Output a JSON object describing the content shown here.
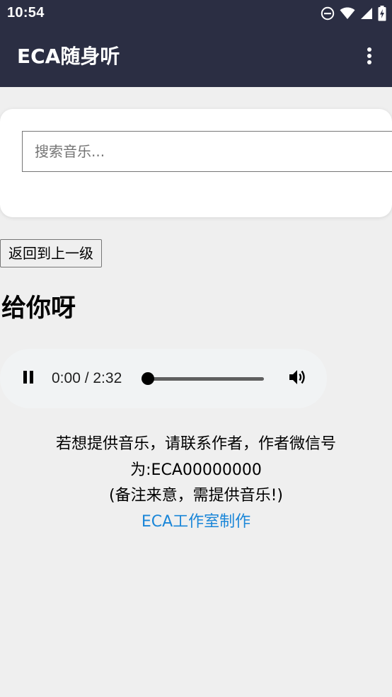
{
  "status_bar": {
    "time": "10:54",
    "icons": [
      "do-not-disturb-icon",
      "wifi-icon",
      "cell-signal-icon",
      "battery-charging-icon"
    ]
  },
  "app_bar": {
    "title": "ECA随身听",
    "menu_icon": "more-vert-icon"
  },
  "search": {
    "placeholder": "搜索音乐..."
  },
  "back_button": {
    "label": "返回到上一级"
  },
  "song": {
    "title": "给你呀"
  },
  "player": {
    "time": "0:00 / 2:32",
    "current": "0:00",
    "duration": "2:32",
    "progress": 0,
    "state": "playing",
    "play_icon": "pause-icon",
    "volume_icon": "volume-icon"
  },
  "info": {
    "line1": "若想提供音乐，请联系作者，作者微信号",
    "line2": "为:ECA00000000",
    "line3": "(备注来意，需提供音乐!)",
    "credit": "ECA工作室制作"
  },
  "colors": {
    "header_bg": "#2b2e43",
    "page_bg": "#efefef",
    "player_bg": "#f1f3f4",
    "link": "#1a86d8"
  }
}
